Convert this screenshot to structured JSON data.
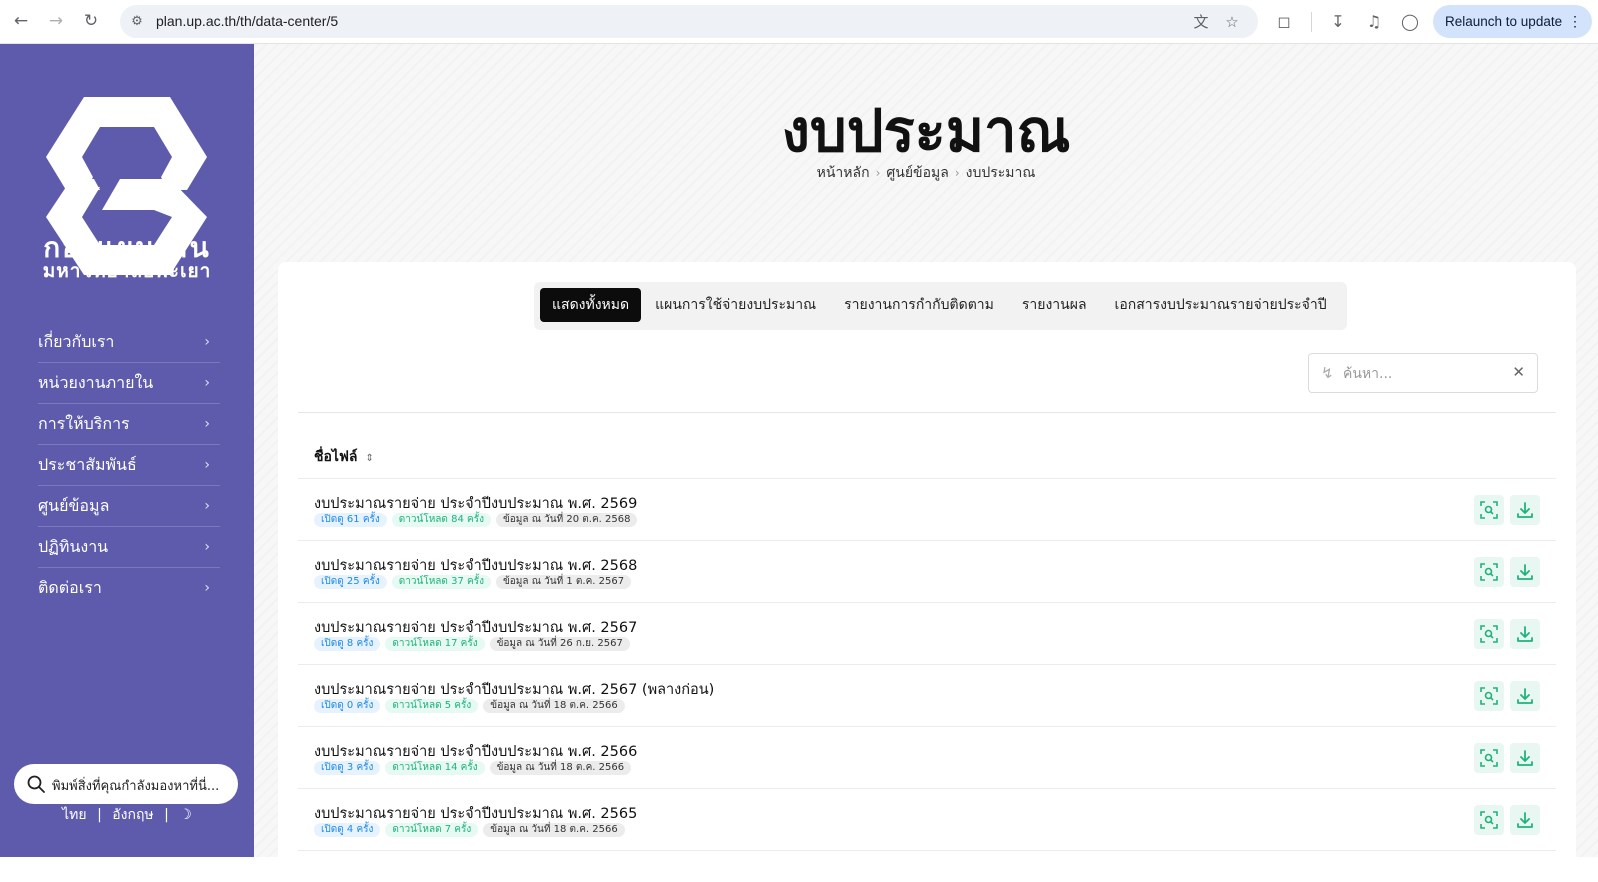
{
  "browser": {
    "url": "plan.up.ac.th/th/data-center/5",
    "relaunch_label": "Relaunch to update"
  },
  "sidebar": {
    "logo_line1": "กองแผนงาน",
    "logo_line2": "มหาวิทยาลัยพะเยา",
    "menu": [
      {
        "label": "เกี่ยวกับเรา"
      },
      {
        "label": "หน่วยงานภายใน"
      },
      {
        "label": "การให้บริการ"
      },
      {
        "label": "ประชาสัมพันธ์"
      },
      {
        "label": "ศูนย์ข้อมูล"
      },
      {
        "label": "ปฏิทินงาน"
      },
      {
        "label": "ติดต่อเรา"
      }
    ],
    "search_placeholder": "พิมพ์สิ่งที่คุณกำลังมองหาที่นี่...",
    "lang_th": "ไทย",
    "lang_en": "อังกฤษ",
    "lang_sep": "|"
  },
  "page": {
    "title": "งบประมาณ",
    "breadcrumb": [
      "หน้าหลัก",
      "ศูนย์ข้อมูล",
      "งบประมาณ"
    ]
  },
  "tabs": [
    {
      "label": "แสดงทั้งหมด",
      "active": true
    },
    {
      "label": "แผนการใช้จ่ายงบประมาณ",
      "active": false
    },
    {
      "label": "รายงานการกำกับติดตาม",
      "active": false
    },
    {
      "label": "รายงานผล",
      "active": false
    },
    {
      "label": "เอกสารงบประมาณรายจ่ายประจำปี",
      "active": false
    }
  ],
  "search": {
    "placeholder": "ค้นหา..."
  },
  "table": {
    "column_header": "ชื่อไฟล์",
    "rows": [
      {
        "title": "งบประมาณรายจ่าย ประจำปีงบประมาณ พ.ศ. 2569",
        "opens": "เปิดดู 61 ครั้ง",
        "downloads": "ดาวน์โหลด 84 ครั้ง",
        "date": "ข้อมูล ณ วันที่ 20 ต.ค. 2568"
      },
      {
        "title": "งบประมาณรายจ่าย ประจำปีงบประมาณ พ.ศ. 2568",
        "opens": "เปิดดู 25 ครั้ง",
        "downloads": "ดาวน์โหลด 37 ครั้ง",
        "date": "ข้อมูล ณ วันที่ 1 ต.ค. 2567"
      },
      {
        "title": "งบประมาณรายจ่าย ประจำปีงบประมาณ พ.ศ. 2567",
        "opens": "เปิดดู 8 ครั้ง",
        "downloads": "ดาวน์โหลด 17 ครั้ง",
        "date": "ข้อมูล ณ วันที่ 26 ก.ย. 2567"
      },
      {
        "title": "งบประมาณรายจ่าย ประจำปีงบประมาณ พ.ศ. 2567 (พลางก่อน)",
        "opens": "เปิดดู 0 ครั้ง",
        "downloads": "ดาวน์โหลด 5 ครั้ง",
        "date": "ข้อมูล ณ วันที่ 18 ต.ค. 2566"
      },
      {
        "title": "งบประมาณรายจ่าย ประจำปีงบประมาณ พ.ศ. 2566",
        "opens": "เปิดดู 3 ครั้ง",
        "downloads": "ดาวน์โหลด 14 ครั้ง",
        "date": "ข้อมูล ณ วันที่ 18 ต.ค. 2566"
      },
      {
        "title": "งบประมาณรายจ่าย ประจำปีงบประมาณ พ.ศ. 2565",
        "opens": "เปิดดู 4 ครั้ง",
        "downloads": "ดาวน์โหลด 7 ครั้ง",
        "date": "ข้อมูล ณ วันที่ 18 ต.ค. 2566"
      }
    ]
  },
  "colors": {
    "sidebar_bg": "#5f5bac",
    "accent_green": "#20b27c",
    "open_badge": "#1e88e5",
    "active_tab": "#0c0c0c"
  }
}
